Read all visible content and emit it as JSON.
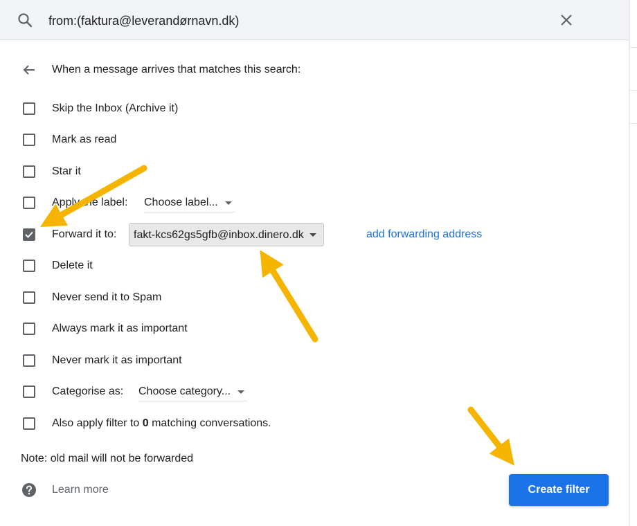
{
  "search": {
    "query": "from:(faktura@leverandørnavn.dk)",
    "search_icon": "search-icon",
    "close_icon": "close-icon"
  },
  "header": {
    "back_icon": "arrow-back-icon",
    "text": "When a message arrives that matches this search:"
  },
  "options": {
    "skip_inbox": {
      "label": "Skip the Inbox (Archive it)",
      "checked": false
    },
    "mark_read": {
      "label": "Mark as read",
      "checked": false
    },
    "star": {
      "label": "Star it",
      "checked": false
    },
    "apply_label": {
      "label": "Apply the label:",
      "dropdown": "Choose label...",
      "checked": false
    },
    "forward": {
      "label": "Forward it to:",
      "dropdown": "fakt-kcs62gs5gfb@inbox.dinero.dk",
      "link": "add forwarding address",
      "checked": true
    },
    "delete": {
      "label": "Delete it",
      "checked": false
    },
    "never_spam": {
      "label": "Never send it to Spam",
      "checked": false
    },
    "always_important": {
      "label": "Always mark it as important",
      "checked": false
    },
    "never_important": {
      "label": "Never mark it as important",
      "checked": false
    },
    "categorise": {
      "label": "Categorise as:",
      "dropdown": "Choose category...",
      "checked": false
    },
    "also_apply": {
      "label_before": "Also apply filter to ",
      "count": "0",
      "label_after": " matching conversations.",
      "checked": false
    }
  },
  "note": "Note: old mail will not be forwarded",
  "learn_more": {
    "icon": "help-icon",
    "label": "Learn more"
  },
  "create_button": "Create filter",
  "colors": {
    "accent": "#1a73e8",
    "annotation_arrow": "#f4b400",
    "checkbox": "#5f6368",
    "search_bg": "#f1f3f4"
  }
}
